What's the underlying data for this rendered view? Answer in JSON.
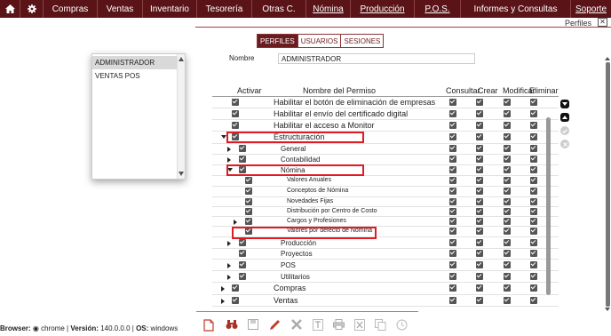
{
  "nav": {
    "home_icon": "home-icon",
    "settings_icon": "gear-icon",
    "items": [
      {
        "label": "Compras"
      },
      {
        "label": "Ventas"
      },
      {
        "label": "Inventario"
      },
      {
        "label": "Tesorería"
      },
      {
        "label": "Otras C."
      },
      {
        "label": "Nómina"
      },
      {
        "label": "Producción"
      },
      {
        "label": "P.O.S."
      },
      {
        "label": "Informes y Consultas"
      },
      {
        "label": "Soporte"
      }
    ]
  },
  "breadcrumb": {
    "label": "Perfiles",
    "close": "✕"
  },
  "tabs": [
    {
      "label": "PERFILES",
      "active": true
    },
    {
      "label": "USUARIOS",
      "active": false
    },
    {
      "label": "SESIONES",
      "active": false
    }
  ],
  "profiles": {
    "items": [
      "ADMINISTRADOR",
      "VENTAS POS"
    ],
    "selected": "ADMINISTRADOR"
  },
  "form": {
    "nombre_label": "Nombre",
    "nombre_value": "ADMINISTRADOR"
  },
  "table": {
    "headers": {
      "activar": "Activar",
      "nombre": "Nombre del Permiso",
      "consultar": "Consultar",
      "crear": "Crear",
      "modificar": "Modificar",
      "eliminar": "Eliminar"
    },
    "rows": [
      {
        "label": "Habilitar el botón de eliminación de empresas",
        "level": 0,
        "expander": "none"
      },
      {
        "label": "Habilitar el envío del certificado digital",
        "level": 0,
        "expander": "none"
      },
      {
        "label": "Habilitar el acceso a Monitor",
        "level": 0,
        "expander": "none"
      },
      {
        "label": "Estructuración",
        "level": 0,
        "expander": "down"
      },
      {
        "label": "General",
        "level": 1,
        "expander": "right"
      },
      {
        "label": "Contabilidad",
        "level": 1,
        "expander": "right"
      },
      {
        "label": "Nómina",
        "level": 1,
        "expander": "down"
      },
      {
        "label": "Valores Anuales",
        "level": 2,
        "expander": "none"
      },
      {
        "label": "Conceptos de Nómina",
        "level": 2,
        "expander": "none"
      },
      {
        "label": "Novedades Fijas",
        "level": 2,
        "expander": "none"
      },
      {
        "label": "Distribución por Centro de Costo",
        "level": 2,
        "expander": "none"
      },
      {
        "label": "Cargos y Profesiones",
        "level": 2,
        "expander": "right"
      },
      {
        "label": "Valores por defecto de Nómina",
        "level": 2,
        "expander": "none"
      },
      {
        "label": "Producción",
        "level": 1,
        "expander": "right"
      },
      {
        "label": "Proyectos",
        "level": 1,
        "expander": "none"
      },
      {
        "label": "POS",
        "level": 1,
        "expander": "right"
      },
      {
        "label": "Utilitarios",
        "level": 1,
        "expander": "right"
      },
      {
        "label": "Compras",
        "level": 0,
        "expander": "right"
      },
      {
        "label": "Ventas",
        "level": 0,
        "expander": "right"
      }
    ]
  },
  "side_buttons": [
    "expand-icon",
    "collapse-icon",
    "check-icon",
    "delete-icon"
  ],
  "footer": {
    "browser_label": "Browser:",
    "browser_value": "chrome",
    "version_label": "Versión:",
    "version_value": "140.0.0.0",
    "os_label": "OS:",
    "os_value": "windows"
  },
  "toolbar": [
    "new-document-icon",
    "search-binoculars-icon",
    "save-icon",
    "edit-pencil-icon",
    "delete-x-icon",
    "text-icon",
    "print-icon",
    "excel-icon",
    "copy-icon",
    "history-icon"
  ]
}
